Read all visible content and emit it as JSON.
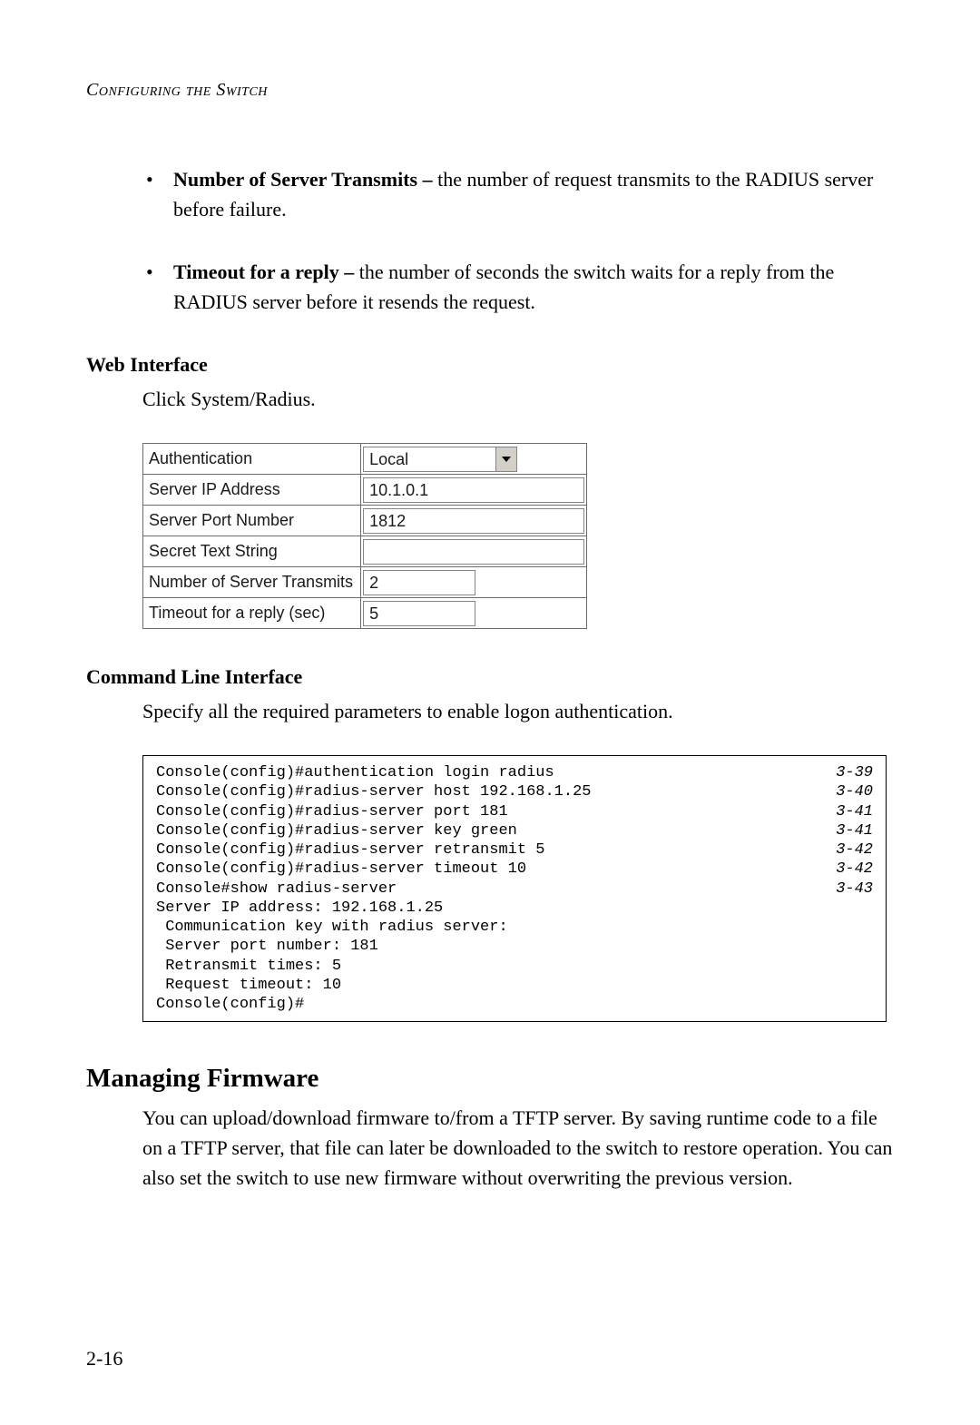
{
  "running_head": "Configuring the Switch",
  "bullets": [
    {
      "label": "Number of Server Transmits – ",
      "text": "the number of request transmits to the RADIUS server before failure."
    },
    {
      "label": "Timeout for a reply – ",
      "text": "the number of seconds the switch waits for a reply from the RADIUS server before it resends the request."
    }
  ],
  "web_interface": {
    "heading": "Web Interface",
    "instruction": "Click System/Radius.",
    "rows": {
      "authentication": {
        "label": "Authentication",
        "value": "Local"
      },
      "server_ip": {
        "label": "Server IP Address",
        "value": "10.1.0.1"
      },
      "server_port": {
        "label": "Server Port Number",
        "value": "1812"
      },
      "secret": {
        "label": "Secret Text String",
        "value": ""
      },
      "transmits": {
        "label": "Number of Server Transmits",
        "value": "2"
      },
      "timeout": {
        "label": "Timeout for a reply (sec)",
        "value": "5"
      }
    }
  },
  "cli": {
    "heading": "Command Line Interface",
    "instruction": "Specify all the required parameters to enable logon authentication.",
    "lines": [
      {
        "text": "Console(config)#authentication login radius",
        "ref": "3-39"
      },
      {
        "text": "Console(config)#radius-server host 192.168.1.25",
        "ref": "3-40"
      },
      {
        "text": "Console(config)#radius-server port 181",
        "ref": "3-41"
      },
      {
        "text": "Console(config)#radius-server key green",
        "ref": "3-41"
      },
      {
        "text": "Console(config)#radius-server retransmit 5",
        "ref": "3-42"
      },
      {
        "text": "Console(config)#radius-server timeout 10",
        "ref": "3-42"
      },
      {
        "text": "Console#show radius-server",
        "ref": "3-43"
      },
      {
        "text": "Server IP address: 192.168.1.25",
        "ref": ""
      },
      {
        "text": " Communication key with radius server:",
        "ref": ""
      },
      {
        "text": " Server port number: 181",
        "ref": ""
      },
      {
        "text": " Retransmit times: 5",
        "ref": ""
      },
      {
        "text": " Request timeout: 10",
        "ref": ""
      },
      {
        "text": "Console(config)#",
        "ref": ""
      }
    ]
  },
  "firmware": {
    "heading": "Managing Firmware",
    "body": "You can upload/download firmware to/from a TFTP server. By saving runtime code to a file on a TFTP server, that file can later be downloaded to the switch to restore operation. You can also set the switch to use new firmware without overwriting the previous version."
  },
  "page_number": "2-16"
}
